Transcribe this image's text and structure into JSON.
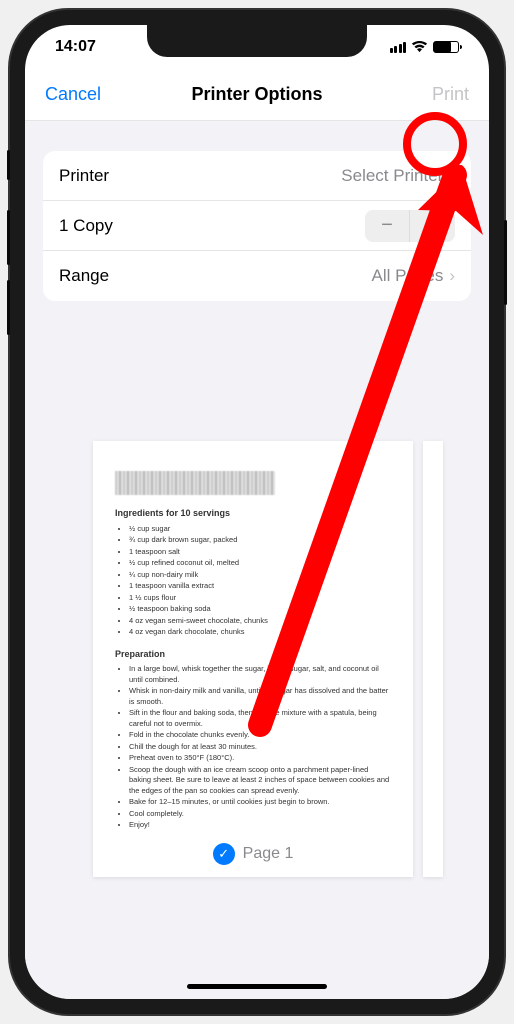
{
  "status": {
    "time": "14:07"
  },
  "nav": {
    "cancel": "Cancel",
    "title": "Printer Options",
    "print": "Print"
  },
  "settings": {
    "printer_label": "Printer",
    "printer_value": "Select Printer",
    "copies_label": "1 Copy",
    "range_label": "Range",
    "range_value": "All Pages"
  },
  "preview": {
    "ingredients_title": "Ingredients for 10 servings",
    "ingredients": [
      "½ cup sugar",
      "¾ cup dark brown sugar, packed",
      "1 teaspoon salt",
      "½ cup refined coconut oil, melted",
      "¼ cup non-dairy milk",
      "1 teaspoon vanilla extract",
      "1 ½ cups flour",
      "½ teaspoon baking soda",
      "4 oz vegan semi-sweet chocolate, chunks",
      "4 oz vegan dark chocolate, chunks"
    ],
    "preparation_title": "Preparation",
    "preparation": [
      "In a large bowl, whisk together the sugar, brown sugar, salt, and coconut oil until combined.",
      "Whisk in non-dairy milk and vanilla, until all sugar has dissolved and the batter is smooth.",
      "Sift in the flour and baking soda, then fold the mixture with a spatula, being careful not to overmix.",
      "Fold in the chocolate chunks evenly.",
      "Chill the dough for at least 30 minutes.",
      "Preheat oven to 350°F (180°C).",
      "Scoop the dough with an ice cream scoop onto a parchment paper-lined baking sheet. Be sure to leave at least 2 inches of space between cookies and the edges of the pan so cookies can spread evenly.",
      "Bake for 12–15 minutes, or until cookies just begin to brown.",
      "Cool completely.",
      "Enjoy!"
    ],
    "page_label": "Page 1"
  },
  "annotation": {
    "highlight_target": "print-button",
    "color": "#ff0000"
  }
}
